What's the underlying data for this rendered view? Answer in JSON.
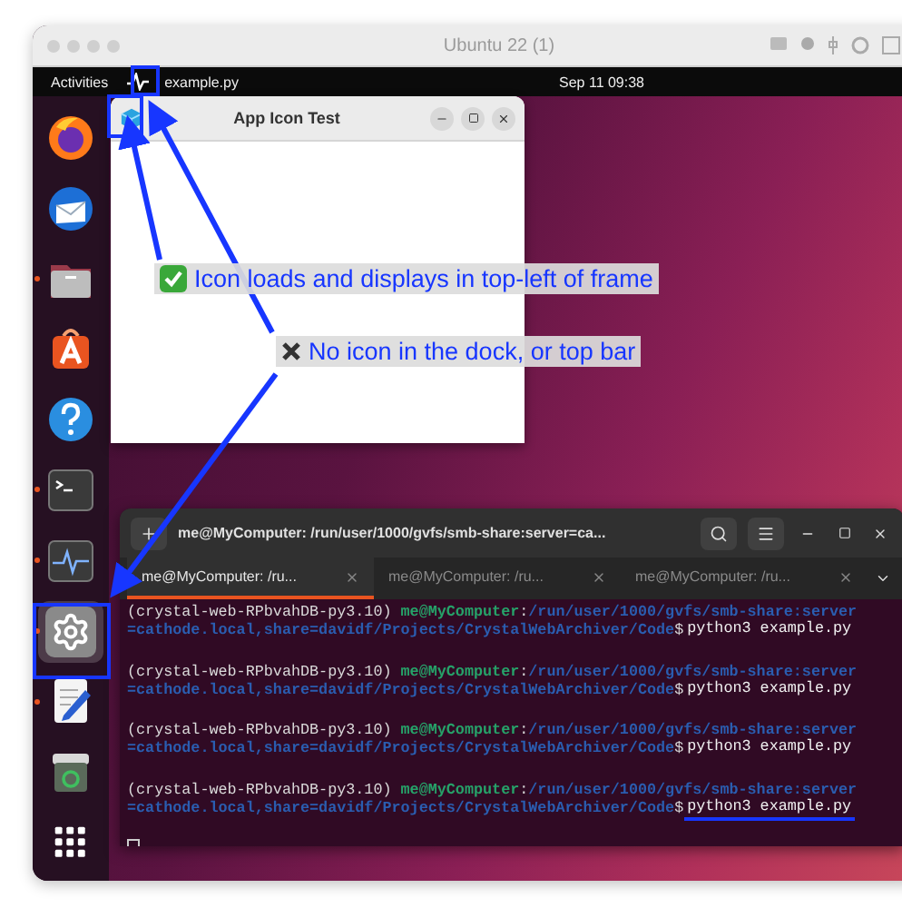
{
  "host_window": {
    "title": "Ubuntu 22 (1)"
  },
  "top_bar": {
    "activities": "Activities",
    "app_name": "example.py",
    "clock": "Sep 11  09:38"
  },
  "dock": {
    "items": [
      {
        "kind": "firefox",
        "running": false,
        "selected": false
      },
      {
        "kind": "mail",
        "running": false,
        "selected": false
      },
      {
        "kind": "files",
        "running": true,
        "selected": false
      },
      {
        "kind": "store",
        "running": false,
        "selected": false
      },
      {
        "kind": "help",
        "running": false,
        "selected": false
      },
      {
        "kind": "terminal",
        "running": true,
        "selected": false
      },
      {
        "kind": "monitor",
        "running": true,
        "selected": false
      },
      {
        "kind": "settings",
        "running": true,
        "selected": true
      },
      {
        "kind": "editor",
        "running": true,
        "selected": false
      },
      {
        "kind": "trash",
        "running": false,
        "selected": false
      },
      {
        "kind": "apps",
        "running": false,
        "selected": false
      }
    ]
  },
  "app_window": {
    "title": "App Icon Test"
  },
  "terminal": {
    "title": "me@MyComputer: /run/user/1000/gvfs/smb-share:server=ca...",
    "tabs": [
      {
        "label": "me@MyComputer: /ru...",
        "selected": true
      },
      {
        "label": "me@MyComputer: /ru...",
        "selected": false
      },
      {
        "label": "me@MyComputer: /ru...",
        "selected": false
      }
    ],
    "lines": [
      {
        "env": "(crystal-web-RPbvahDB-py3.10)",
        "user": "me@MyComputer",
        "separator": ":",
        "path_head": "/run/user/1000/gvfs/smb-share:server",
        "path_tail": "=cathode.local,share=davidf/Projects/CrystalWebArchiver/Code",
        "prompt": "$",
        "command": "python3 example.py",
        "highlighted": false
      },
      {
        "env": "(crystal-web-RPbvahDB-py3.10)",
        "user": "me@MyComputer",
        "separator": ":",
        "path_head": "/run/user/1000/gvfs/smb-share:server",
        "path_tail": "=cathode.local,share=davidf/Projects/CrystalWebArchiver/Code",
        "prompt": "$",
        "command": "python3 example.py",
        "highlighted": false
      },
      {
        "env": "(crystal-web-RPbvahDB-py3.10)",
        "user": "me@MyComputer",
        "separator": ":",
        "path_head": "/run/user/1000/gvfs/smb-share:server",
        "path_tail": "=cathode.local,share=davidf/Projects/CrystalWebArchiver/Code",
        "prompt": "$",
        "command": "python3 example.py",
        "highlighted": false
      },
      {
        "env": "(crystal-web-RPbvahDB-py3.10)",
        "user": "me@MyComputer",
        "separator": ":",
        "path_head": "/run/user/1000/gvfs/smb-share:server",
        "path_tail": "=cathode.local,share=davidf/Projects/CrystalWebArchiver/Code",
        "prompt": "$",
        "command": "python3 example.py",
        "highlighted": true
      }
    ]
  },
  "annotations": [
    {
      "kind": "check",
      "text": "Icon loads and displays in top-left of frame"
    },
    {
      "kind": "cross",
      "text": "No icon in the dock, or top bar"
    }
  ]
}
